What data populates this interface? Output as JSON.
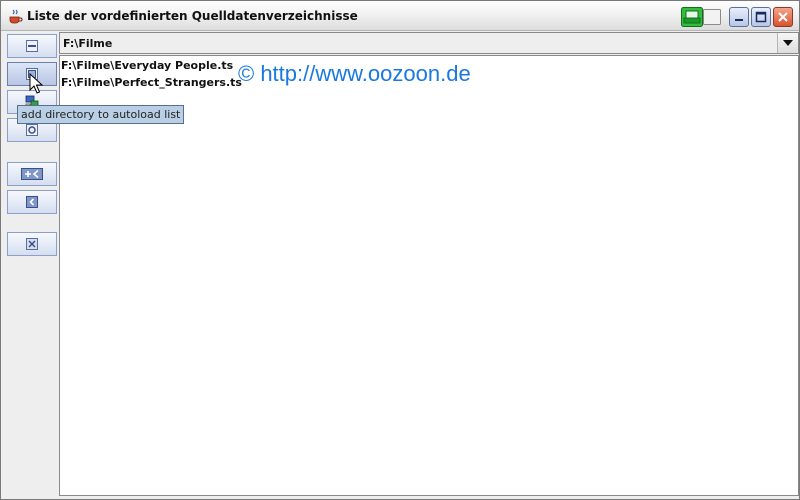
{
  "window": {
    "title": "Liste der vordefinierten Quelldatenverzeichnisse"
  },
  "titlebar_buttons": [
    "minimize-icon",
    "maximize-icon",
    "close-icon"
  ],
  "sidebar": {
    "buttons": [
      {
        "icon": "remove-icon"
      },
      {
        "icon": "add-directory-icon"
      },
      {
        "icon": "network-directory-icon"
      },
      {
        "icon": "settings-icon"
      },
      {
        "icon": "add-all-left-icon"
      },
      {
        "icon": "move-left-icon"
      },
      {
        "icon": "delete-icon"
      }
    ],
    "tooltip": "add directory to autoload list"
  },
  "combo": {
    "selected": "F:\\Filme"
  },
  "list": {
    "items": [
      "F:\\Filme\\Everyday People.ts",
      "F:\\Filme\\Perfect_Strangers.ts"
    ],
    "watermark": "© http://www.oozoon.de"
  },
  "colors": {
    "watermark": "#1a78e0",
    "tooltip_bg": "#b8cfe5",
    "close_button": "#d9542f"
  }
}
